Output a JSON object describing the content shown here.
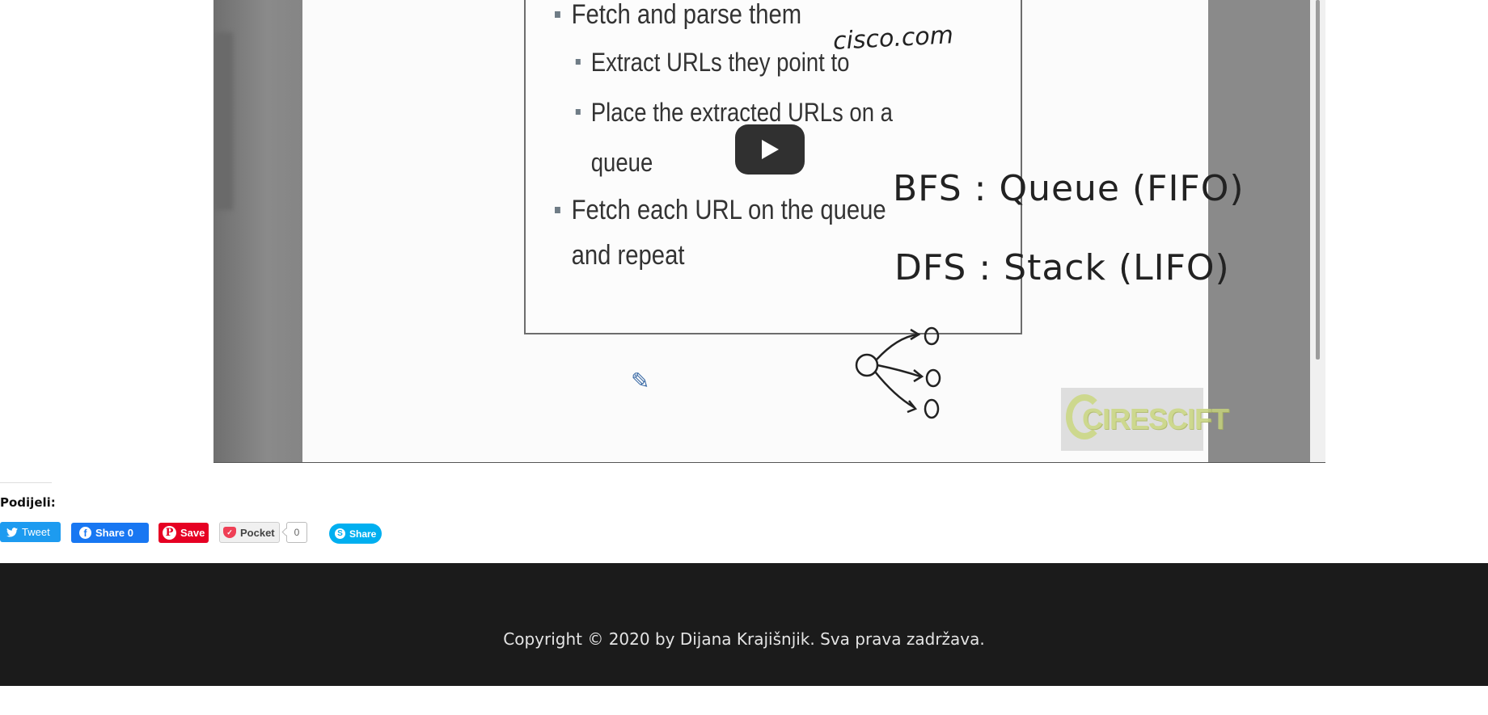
{
  "video": {
    "slide_bullets": [
      {
        "level": 1,
        "text": "Fetch and parse them"
      },
      {
        "level": 2,
        "text": "Extract URLs they point to"
      },
      {
        "level": 2,
        "text": "Place the extracted URLs on a queue"
      },
      {
        "level": 1,
        "text": "Fetch each URL on the queue and repeat"
      }
    ],
    "handwriting": {
      "site": "cisco.com",
      "bfs": "BFS : Queue (FIFO)",
      "dfs": "DFS : Stack (LIFO)"
    },
    "watermark": "CIRESCIFT",
    "play_button_icon": "play-icon"
  },
  "share": {
    "title": "Podijeli:",
    "tweet": "Tweet",
    "facebook": "Share 0",
    "pinterest": "Save",
    "pocket": "Pocket",
    "pocket_count": "0",
    "skype": "Share"
  },
  "colors": {
    "twitter": "#1d9bf0",
    "facebook": "#1877f2",
    "pinterest": "#e60023",
    "skype": "#00aff0",
    "footer_bg": "#1b1b1b"
  },
  "footer": {
    "copyright": "Copyright © 2020 by Dijana Krajišnjik. Sva prava zadržava."
  }
}
